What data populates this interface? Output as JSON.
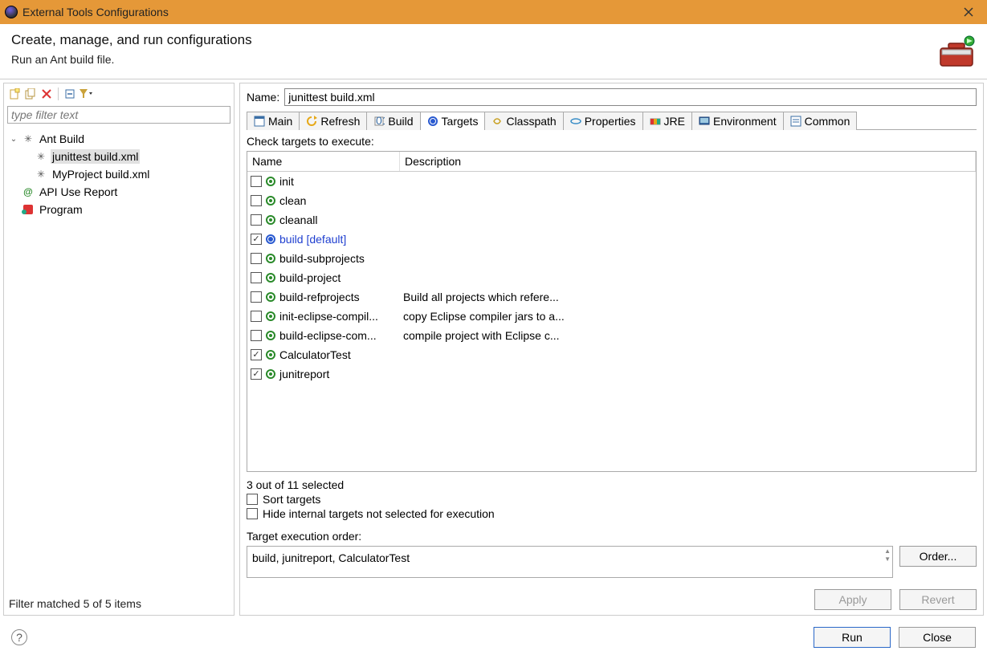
{
  "window": {
    "title": "External Tools Configurations"
  },
  "header": {
    "title": "Create, manage, and run configurations",
    "subtitle": "Run an Ant build file."
  },
  "left": {
    "filter_placeholder": "type filter text",
    "tree": [
      {
        "label": "Ant Build"
      },
      {
        "label": "junittest build.xml"
      },
      {
        "label": "MyProject build.xml"
      },
      {
        "label": "API Use Report"
      },
      {
        "label": "Program"
      }
    ],
    "status": "Filter matched 5 of 5 items"
  },
  "config": {
    "name_label": "Name:",
    "name_value": "junittest build.xml",
    "tabs": [
      "Main",
      "Refresh",
      "Build",
      "Targets",
      "Classpath",
      "Properties",
      "JRE",
      "Environment",
      "Common"
    ],
    "active_tab": "Targets"
  },
  "targets": {
    "check_label": "Check targets to execute:",
    "columns": {
      "name": "Name",
      "desc": "Description"
    },
    "rows": [
      {
        "checked": false,
        "name": "init",
        "desc": ""
      },
      {
        "checked": false,
        "name": "clean",
        "desc": ""
      },
      {
        "checked": false,
        "name": "cleanall",
        "desc": ""
      },
      {
        "checked": true,
        "name": "build [default]",
        "desc": "",
        "default": true
      },
      {
        "checked": false,
        "name": "build-subprojects",
        "desc": ""
      },
      {
        "checked": false,
        "name": "build-project",
        "desc": ""
      },
      {
        "checked": false,
        "name": "build-refprojects",
        "desc": "Build all projects which refere..."
      },
      {
        "checked": false,
        "name": "init-eclipse-compil...",
        "desc": "copy Eclipse compiler jars to a..."
      },
      {
        "checked": false,
        "name": "build-eclipse-com...",
        "desc": "compile project with Eclipse c..."
      },
      {
        "checked": true,
        "name": "CalculatorTest",
        "desc": ""
      },
      {
        "checked": true,
        "name": "junitreport",
        "desc": ""
      }
    ],
    "selection_count": "3 out of 11 selected",
    "sort_label": "Sort targets",
    "hide_label": "Hide internal targets not selected for execution",
    "order_label": "Target execution order:",
    "order_value": "build, junitreport, CalculatorTest",
    "order_button": "Order..."
  },
  "buttons": {
    "apply": "Apply",
    "revert": "Revert",
    "run": "Run",
    "close": "Close"
  }
}
